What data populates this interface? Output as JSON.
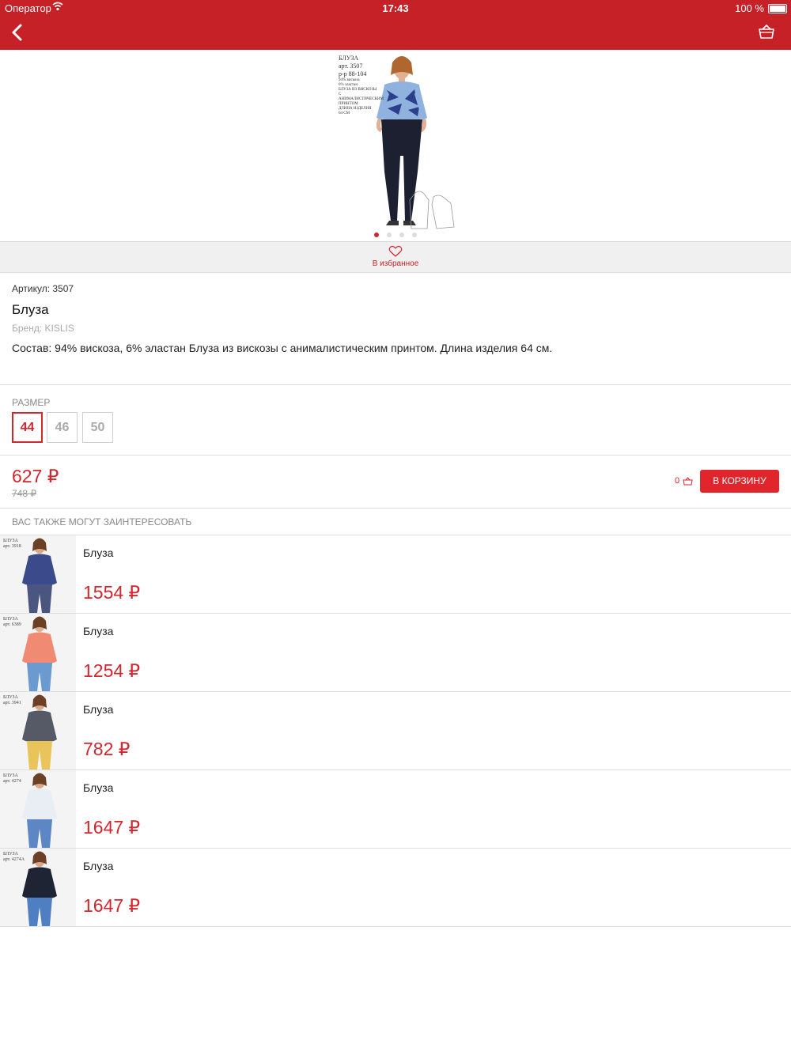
{
  "status_bar": {
    "carrier": "Оператор",
    "time": "17:43",
    "battery": "100 %"
  },
  "nav": {
    "back_icon": "chevron-left-icon",
    "cart_icon": "basket-icon",
    "bar_color": "#c62126"
  },
  "gallery": {
    "image_text_lines": [
      "БЛУЗА",
      "арт. 3507",
      "р-р 88-104",
      "94% вискоза",
      "6% эластан",
      "БЛУЗА ИЗ ВИСКОЗЫ",
      "С АНИМАЛИСТИЧЕСКИМ",
      "ПРИНТОМ",
      "ДЛИНА ИЗДЕЛИЯ",
      "64 СМ"
    ],
    "page_count": 4,
    "active_page": 1
  },
  "favorites": {
    "label": "В избранное",
    "icon": "heart-icon"
  },
  "product": {
    "sku": "Артикул: 3507",
    "title": "Блуза",
    "brand": "Бренд: KISLIS",
    "description": "Состав: 94% вискоза, 6% эластан Блуза из вискозы с анималистическим принтом.   Длина изделия 64 см."
  },
  "sizes": {
    "label": "РАЗМЕР",
    "options": [
      "44",
      "46",
      "50"
    ],
    "selected": "44"
  },
  "purchase": {
    "price": "627 ₽",
    "old_price": "748 ₽",
    "cart_count": "0",
    "cart_button": "В КОРЗИНУ",
    "accent_color": "#e0262c"
  },
  "recommendations": {
    "header": "ВАС ТАКЖЕ МОГУТ ЗАИНТЕРЕСОВАТЬ",
    "items": [
      {
        "name": "Блуза",
        "price": "1554 ₽",
        "thumb_text": [
          "БЛУЗА",
          "арт. 3918"
        ],
        "top_color": "#3b4a8a",
        "bottom_color": "#4a5580",
        "skin": "#d9a88a"
      },
      {
        "name": "Блуза",
        "price": "1254 ₽",
        "thumb_text": [
          "БЛУЗА",
          "арт. 6389"
        ],
        "top_color": "#f08a73",
        "bottom_color": "#6a9ad0",
        "skin": "#e0b090"
      },
      {
        "name": "Блуза",
        "price": "782 ₽",
        "thumb_text": [
          "БЛУЗА",
          "арт. 3941"
        ],
        "top_color": "#555a66",
        "bottom_color": "#e8c45a",
        "skin": "#d9a88a"
      },
      {
        "name": "Блуза",
        "price": "1647 ₽",
        "thumb_text": [
          "БЛУЗА",
          "арт. 4274"
        ],
        "top_color": "#e9eef5",
        "bottom_color": "#5c86c4",
        "skin": "#d9a88a"
      },
      {
        "name": "Блуза",
        "price": "1647 ₽",
        "thumb_text": [
          "БЛУЗА",
          "арт. 4274А"
        ],
        "top_color": "#1e2433",
        "bottom_color": "#4f7fc2",
        "skin": "#d9a88a"
      }
    ]
  }
}
